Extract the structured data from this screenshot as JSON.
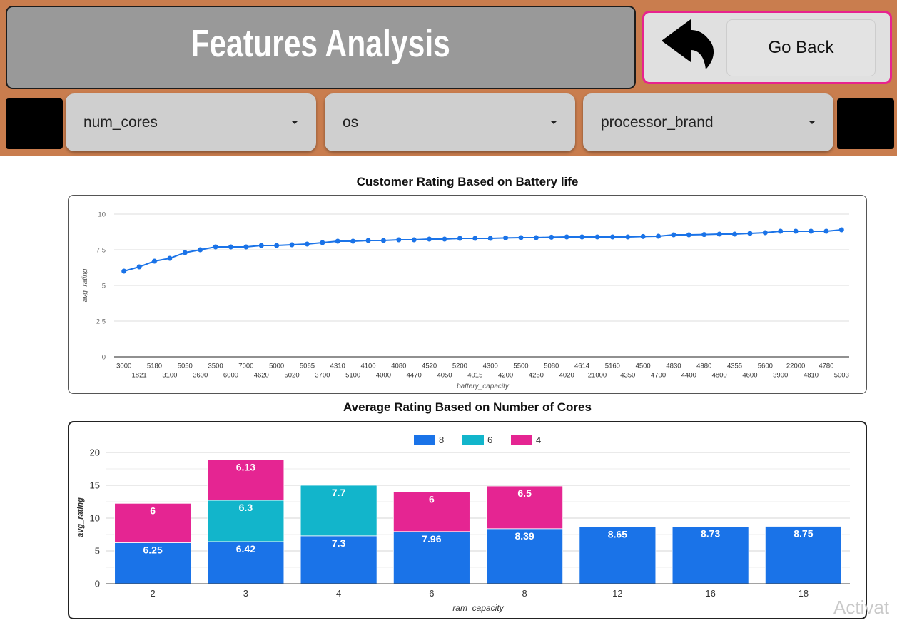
{
  "header": {
    "title": "Features Analysis",
    "bar_color": "#c97d4e",
    "title_box_color": "#999999"
  },
  "back_panel": {
    "icon": "reply-arrow-icon",
    "button_label": "Go Back",
    "border_color": "#e8238e"
  },
  "filters": {
    "dropdown_icon": "caret-down-icon",
    "items": [
      {
        "label": "num_cores"
      },
      {
        "label": "os"
      },
      {
        "label": "processor_brand"
      }
    ]
  },
  "watermark": {
    "text": "Activat"
  },
  "chart_data": [
    {
      "type": "line",
      "title": "Customer Rating Based on Battery life",
      "xlabel": "battery_capacity",
      "ylabel": "avg_rating",
      "x": [
        "3000",
        "1821",
        "5180",
        "3100",
        "5050",
        "3600",
        "3500",
        "6000",
        "7000",
        "4620",
        "5000",
        "5020",
        "5065",
        "3700",
        "4310",
        "5100",
        "4100",
        "4000",
        "4080",
        "4470",
        "4520",
        "4050",
        "5200",
        "4015",
        "4300",
        "4200",
        "5500",
        "4250",
        "5080",
        "4020",
        "4614",
        "21000",
        "5160",
        "4350",
        "4500",
        "4700",
        "4830",
        "4400",
        "4980",
        "4800",
        "4355",
        "4600",
        "5600",
        "3900",
        "22000",
        "4810",
        "4780",
        "5003"
      ],
      "series": [
        {
          "values": [
            6.0,
            6.3,
            6.7,
            6.9,
            7.3,
            7.5,
            7.7,
            7.7,
            7.7,
            7.8,
            7.8,
            7.85,
            7.9,
            8.0,
            8.1,
            8.1,
            8.15,
            8.15,
            8.2,
            8.2,
            8.25,
            8.25,
            8.3,
            8.3,
            8.3,
            8.33,
            8.35,
            8.35,
            8.38,
            8.4,
            8.4,
            8.4,
            8.4,
            8.4,
            8.43,
            8.45,
            8.55,
            8.55,
            8.57,
            8.6,
            8.6,
            8.65,
            8.7,
            8.8,
            8.8,
            8.8,
            8.8,
            8.9
          ]
        }
      ],
      "yticks": [
        0,
        2.5,
        5,
        7.5,
        10
      ],
      "ylim": [
        0,
        10
      ],
      "grid": true,
      "color": "#1a73e8"
    },
    {
      "type": "bar",
      "stacked": true,
      "title": "Average Rating Based on Number of Cores",
      "xlabel": "ram_capacity",
      "ylabel": "avg_rating",
      "categories": [
        "2",
        "3",
        "4",
        "6",
        "8",
        "12",
        "16",
        "18"
      ],
      "series": [
        {
          "name": "8",
          "color": "#1a73e8",
          "values": [
            6.25,
            6.42,
            7.3,
            7.96,
            8.39,
            8.65,
            8.73,
            8.75
          ]
        },
        {
          "name": "6",
          "color": "#12b5cb",
          "values": [
            null,
            6.3,
            7.7,
            null,
            null,
            null,
            null,
            null
          ]
        },
        {
          "name": "4",
          "color": "#e52592",
          "values": [
            6,
            6.13,
            null,
            6,
            6.5,
            null,
            null,
            null
          ]
        }
      ],
      "yticks": [
        0,
        5,
        10,
        15,
        20
      ],
      "ylim": [
        0,
        20
      ],
      "legend": "top-center",
      "grid": true
    }
  ]
}
